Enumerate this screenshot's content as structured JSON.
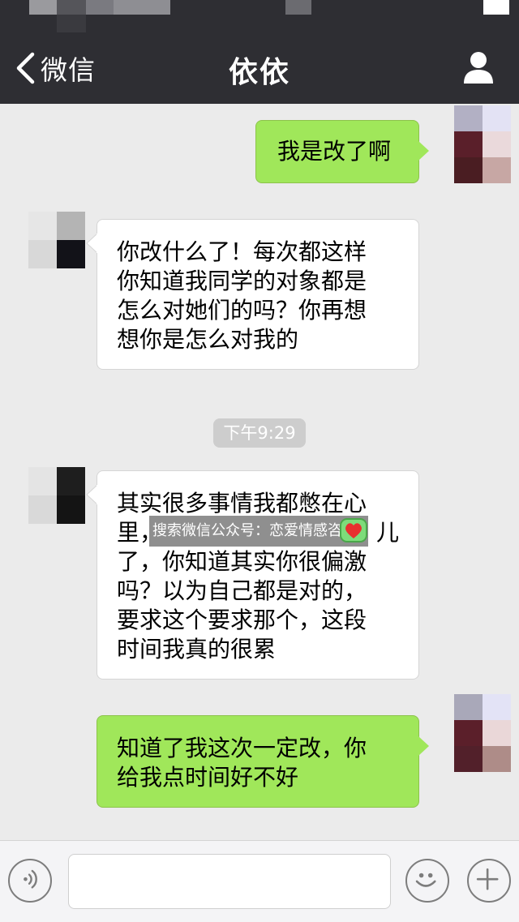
{
  "nav": {
    "back_label": "微信",
    "title": "依依"
  },
  "messages": [
    {
      "side": "out",
      "text": "我是改了啊"
    },
    {
      "side": "in",
      "lines": [
        "你改什么了！每次都这样",
        "你知道我同学的对象都是",
        "怎么对她们的吗？你再想",
        "想你是怎么对我的"
      ]
    },
    {
      "side": "in",
      "lines": [
        "其实很多事情我都憋在心",
        "里，",
        "了，你知道其实你很偏激",
        "吗？以为自己都是对的，",
        "要求这个要求那个，这段",
        "时间我真的很累"
      ],
      "line2_tail": "儿"
    },
    {
      "side": "out",
      "lines": [
        "知道了我这次一定改，你",
        "给我点时间好不好"
      ]
    }
  ],
  "timestamp": "下午9:29",
  "watermark": "搜索微信公众号：恋爱情感咨询",
  "input": {
    "value": "",
    "placeholder": ""
  },
  "icons": {
    "back": "chevron-left-icon",
    "profile": "person-icon",
    "voice": "voice-icon",
    "emoji": "emoji-icon",
    "more": "plus-icon"
  },
  "colors": {
    "nav_bg": "#2e2e33",
    "chat_bg": "#ebebeb",
    "bubble_out": "#a0e75a",
    "bubble_in": "#ffffff"
  }
}
